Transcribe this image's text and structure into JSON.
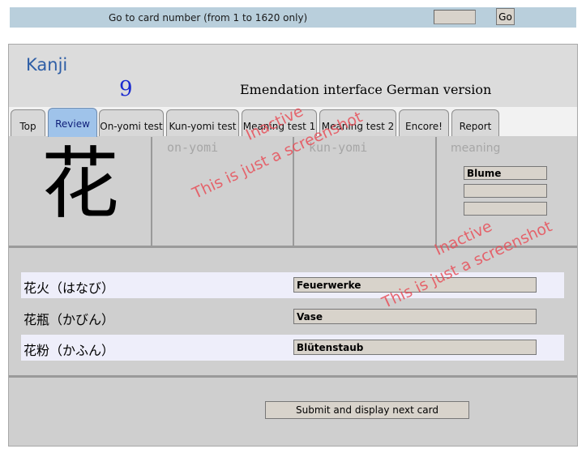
{
  "goto": {
    "label": "Go to card number (from 1 to 1620 only)",
    "input_value": "",
    "button_label": "Go"
  },
  "header": {
    "title": "Kanji",
    "card_number": "9",
    "interface_title": "Emendation interface  German version"
  },
  "tabs": [
    {
      "label": "Top",
      "active": false
    },
    {
      "label": "Review",
      "active": true
    },
    {
      "label": "On-yomi test",
      "active": false
    },
    {
      "label": "Kun-yomi test",
      "active": false
    },
    {
      "label": "Meaning test 1",
      "active": false
    },
    {
      "label": "Meaning test 2",
      "active": false
    },
    {
      "label": "Encore!",
      "active": false
    },
    {
      "label": "Report",
      "active": false
    }
  ],
  "card": {
    "kanji": "花",
    "on_yomi_label": "on-yomi",
    "kun_yomi_label": "kun-yomi",
    "meaning_label": "meaning",
    "meanings": [
      "Blume",
      "",
      ""
    ]
  },
  "vocab": [
    {
      "word": "花火（はなび）",
      "meaning": "Feuerwerke"
    },
    {
      "word": "花瓶（かびん）",
      "meaning": "Vase"
    },
    {
      "word": "花粉（かふん）",
      "meaning": "Blütenstaub"
    }
  ],
  "submit_label": "Submit and display next card",
  "watermark": {
    "line1": "Inactive",
    "line2": "This is just a screenshot",
    "color": "#e8505a"
  }
}
